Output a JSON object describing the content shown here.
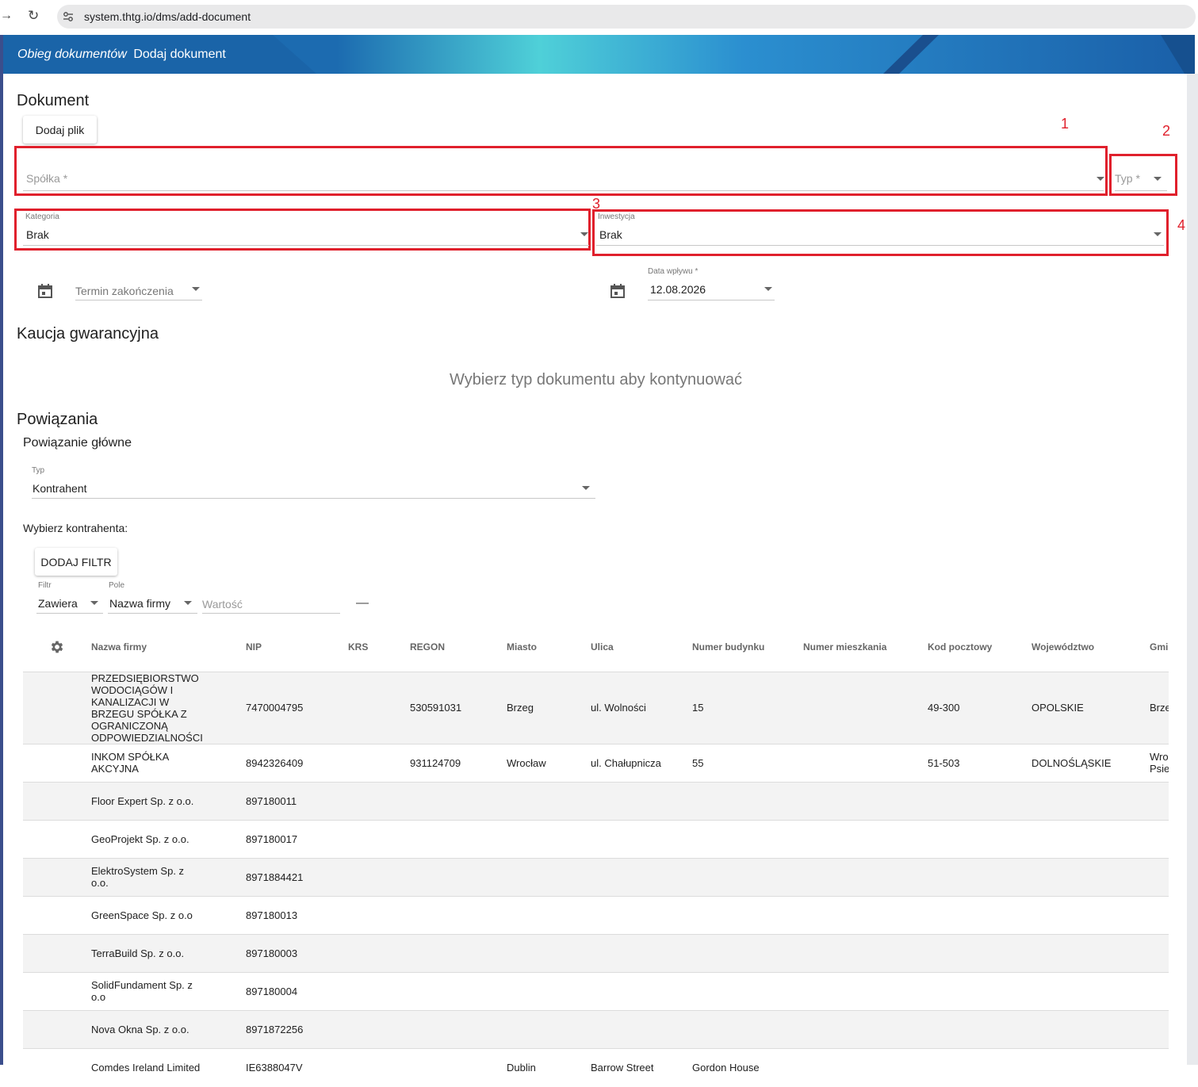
{
  "browser": {
    "url": "system.thtg.io/dms/add-document"
  },
  "header": {
    "section": "Obieg dokumentów",
    "page": "Dodaj dokument"
  },
  "dokument": {
    "title": "Dokument",
    "add_file_label": "Dodaj plik",
    "spolka_placeholder": "Spółka *",
    "typ_placeholder": "Typ *",
    "kategoria_label": "Kategoria",
    "kategoria_value": "Brak",
    "inwestycja_label": "Inwestycja",
    "inwestycja_value": "Brak",
    "termin_placeholder": "Termin zakończenia",
    "data_wplywu_label": "Data wpływu *",
    "data_wplywu_value": "12.08.2026"
  },
  "annotations": {
    "n1": "1",
    "n2": "2",
    "n3": "3",
    "n4": "4",
    "color": "#e0202c"
  },
  "kaucja": {
    "title": "Kaucja gwarancyjna",
    "message": "Wybierz typ dokumentu aby kontynuować"
  },
  "powiazania": {
    "title": "Powiązania",
    "main_title": "Powiązanie główne",
    "typ_label": "Typ",
    "typ_value": "Kontrahent",
    "choose_label": "Wybierz kontrahenta:",
    "add_filter_label": "DODAJ FILTR",
    "filter": {
      "filtr_label": "Filtr",
      "filtr_value": "Zawiera",
      "pole_label": "Pole",
      "pole_value": "Nazwa firmy",
      "wartosc_placeholder": "Wartość",
      "remove_symbol": "—"
    }
  },
  "table": {
    "columns": [
      "Nazwa firmy",
      "NIP",
      "KRS",
      "REGON",
      "Miasto",
      "Ulica",
      "Numer budynku",
      "Numer mieszkania",
      "Kod pocztowy",
      "Województwo",
      "Gmi"
    ],
    "rows": [
      {
        "nazwa": "PRZEDSIĘBIORSTWO WODOCIĄGÓW I KANALIZACJI W BRZEGU SPÓŁKA Z OGRANICZONĄ ODPOWIEDZIALNOŚCIĄ",
        "nip": "7470004795",
        "krs": "",
        "regon": "530591031",
        "miasto": "Brzeg",
        "ulica": "ul. Wolności",
        "budynek": "15",
        "mieszkanie": "",
        "kod": "49-300",
        "wojewodztwo": "OPOLSKIE",
        "gmina": "Brze"
      },
      {
        "nazwa": "INKOM SPÓŁKA AKCYJNA",
        "nip": "8942326409",
        "krs": "",
        "regon": "931124709",
        "miasto": "Wrocław",
        "ulica": "ul. Chałupnicza",
        "budynek": "55",
        "mieszkanie": "",
        "kod": "51-503",
        "wojewodztwo": "DOLNOŚLĄSKIE",
        "gmina": "Wro Psie"
      },
      {
        "nazwa": "Floor Expert Sp. z o.o.",
        "nip": "897180011"
      },
      {
        "nazwa": "GeoProjekt Sp. z o.o.",
        "nip": "897180017"
      },
      {
        "nazwa": "ElektroSystem Sp. z o.o.",
        "nip": "8971884421"
      },
      {
        "nazwa": "GreenSpace Sp. z o.o",
        "nip": "897180013"
      },
      {
        "nazwa": "TerraBuild Sp. z o.o.",
        "nip": "897180003"
      },
      {
        "nazwa": "SolidFundament Sp. z o.o",
        "nip": "897180004"
      },
      {
        "nazwa": "Nova Okna Sp. z o.o.",
        "nip": "8971872256"
      },
      {
        "nazwa": "Comdes Ireland Limited",
        "nip": "IE6388047V",
        "miasto": "Dublin",
        "ulica": "Barrow Street",
        "budynek": "Gordon House"
      }
    ]
  }
}
